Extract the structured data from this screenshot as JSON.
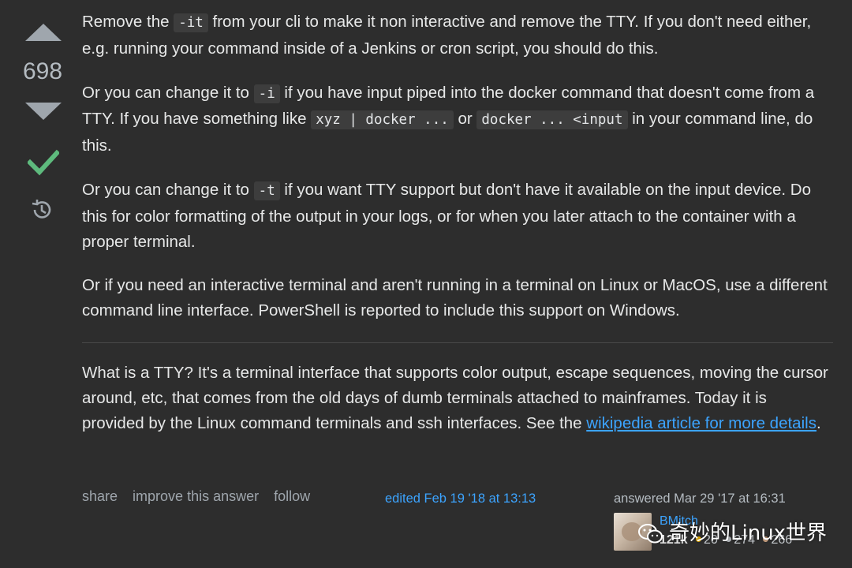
{
  "vote": {
    "count": "698"
  },
  "post": {
    "p1": {
      "t1": "Remove the ",
      "code1": "-it",
      "t2": " from your cli to make it non interactive and remove the TTY. If you don't need either, e.g. running your command inside of a Jenkins or cron script, you should do this."
    },
    "p2": {
      "t1": "Or you can change it to ",
      "code1": "-i",
      "t2": " if you have input piped into the docker command that doesn't come from a TTY. If you have something like ",
      "code2": "xyz | docker ...",
      "t3": " or ",
      "code3": "docker ... <input",
      "t4": " in your command line, do this."
    },
    "p3": {
      "t1": "Or you can change it to ",
      "code1": "-t",
      "t2": " if you want TTY support but don't have it available on the input device. Do this for color formatting of the output in your logs, or for when you later attach to the container with a proper terminal."
    },
    "p4": {
      "t1": "Or if you need an interactive terminal and aren't running in a terminal on Linux or MacOS, use a different command line interface. PowerShell is reported to include this support on Windows."
    },
    "p5": {
      "t1": "What is a TTY? It's a terminal interface that supports color output, escape sequences, moving the cursor around, etc, that comes from the old days of dumb terminals attached to mainframes. Today it is provided by the Linux command terminals and ssh interfaces. See the ",
      "link": "wikipedia article for more details",
      "t2": "."
    }
  },
  "menu": {
    "share": "share",
    "improve": "improve this answer",
    "follow": "follow"
  },
  "edited": "edited Feb 19 '18 at 13:13",
  "answered": "answered Mar 29 '17 at 16:31",
  "user": {
    "name": "BMitch",
    "rep": "121k",
    "gold": "20",
    "silver": "274",
    "bronze": "266"
  },
  "watermark": "奇妙的Linux世界",
  "colors": {
    "background": "#2d2d2d",
    "text": "#e7e8e8",
    "link": "#3ca4ff",
    "accepted": "#5eba7d",
    "muted": "#9fa6ad"
  }
}
